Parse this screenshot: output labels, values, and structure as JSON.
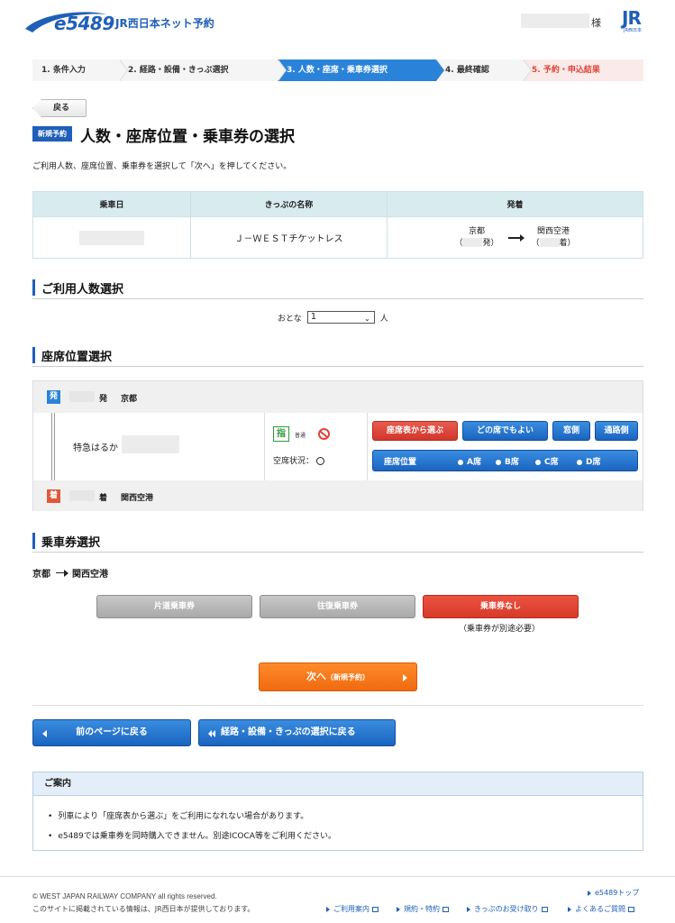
{
  "header": {
    "logo_text": "e5489",
    "site_name": "JR西日本ネット予約",
    "honorific": "様",
    "jr_logo_text": "JR",
    "jr_logo_sub": "JR西日本"
  },
  "stepper": {
    "steps": [
      {
        "label": "1. 条件入力"
      },
      {
        "label": "2. 経路・設備・きっぷ選択"
      },
      {
        "label": "3. 人数・座席・乗車券選択"
      },
      {
        "label": "4. 最終確認"
      },
      {
        "label": "5. 予約・申込結果"
      }
    ],
    "active_index": 2
  },
  "back_button": "戻る",
  "title": {
    "badge": "新規予約",
    "text": "人数・座席位置・乗車券の選択",
    "instruction": "ご利用人数、座席位置、乗車券を選択して「次へ」を押してください。"
  },
  "summary": {
    "headers": [
      "乗車日",
      "きっぷの名称",
      "発着"
    ],
    "ticket_name": "Ｊ－ＷＥＳＴチケットレス",
    "from_station": "京都",
    "from_suffix": "発）",
    "to_station": "関西空港",
    "to_suffix": "着）",
    "paren_open": "（"
  },
  "people_section": {
    "heading": "ご利用人数選択",
    "label": "おとな",
    "value": "1",
    "unit": "人"
  },
  "seat_section": {
    "heading": "座席位置選択",
    "dep_badge": "発",
    "dep_suffix": "発",
    "dep_station": "京都",
    "arr_badge": "着",
    "arr_suffix": "着",
    "arr_station": "関西空港",
    "train_name": "特急はるか",
    "reserved_icon": "指",
    "car_type": "普通",
    "vacancy_label": "空席状況：",
    "buttons": {
      "seat_map": "座席表から選ぶ",
      "any_seat": "どの席でもよい",
      "window": "窓側",
      "aisle": "通路側"
    },
    "seat_position": {
      "label": "座席位置",
      "options": [
        "A席",
        "B席",
        "C席",
        "D席"
      ]
    }
  },
  "ticket_section": {
    "heading": "乗車券選択",
    "route_from": "京都",
    "route_to": "関西空港",
    "buttons": {
      "one_way": "片道乗車券",
      "round_trip": "往復乗車券",
      "none": "乗車券なし"
    },
    "note": "（乗車券が別途必要）"
  },
  "next_button": {
    "label": "次へ",
    "sub": "（新規予約）"
  },
  "nav_buttons": {
    "prev_page": "前のページに戻る",
    "back_route": "経路・設備・きっぷの選択に戻る"
  },
  "guide": {
    "heading": "ご案内",
    "items": [
      "列車により「座席表から選ぶ」をご利用になれない場合があります。",
      "e5489では乗車券を同時購入できません。別途ICOCA等をご利用ください。"
    ]
  },
  "footer": {
    "copyright": "© WEST JAPAN RAILWAY COMPANY all rights reserved.",
    "info": "このサイトに掲載されている情報は、JR西日本が提供しております。",
    "top_link": "e5489トップ",
    "links": [
      "ご利用案内",
      "規約・特約",
      "きっぷのお受け取り",
      "よくあるご質問"
    ]
  },
  "colors": {
    "brand_blue": "#1f5fb8",
    "active_step": "#2a83d9",
    "next_orange": "#f06a10",
    "selected_red": "#d63a29"
  }
}
